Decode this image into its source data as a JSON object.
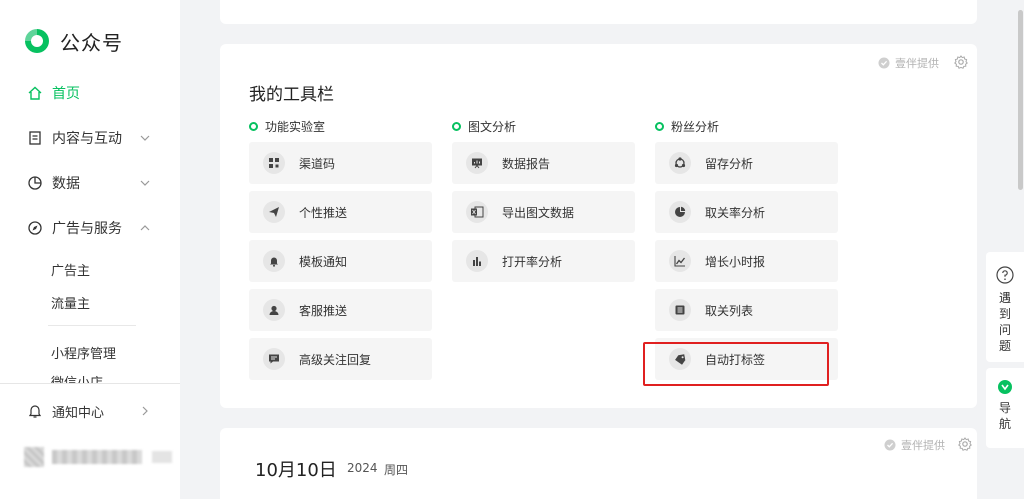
{
  "app": {
    "logo_text": "公众号",
    "brand_color": "#07c160"
  },
  "sidebar": {
    "items": [
      {
        "label": "首页",
        "icon": "home-icon",
        "active": true
      },
      {
        "label": "内容与互动",
        "icon": "document-icon",
        "chevron": "down"
      },
      {
        "label": "数据",
        "icon": "pie-chart-icon",
        "chevron": "down"
      },
      {
        "label": "广告与服务",
        "icon": "compass-icon",
        "chevron": "up"
      }
    ],
    "sub_items": [
      "广告主",
      "流量主",
      "小程序管理",
      "微信小店"
    ],
    "notification": {
      "label": "通知中心",
      "icon": "bell-icon"
    }
  },
  "tools_card": {
    "title": "我的工具栏",
    "sponsor_label": "壹伴提供",
    "columns": [
      {
        "heading": "功能实验室",
        "tools": [
          {
            "label": "渠道码",
            "icon": "qrcode-icon"
          },
          {
            "label": "个性推送",
            "icon": "send-icon"
          },
          {
            "label": "模板通知",
            "icon": "bell-icon"
          },
          {
            "label": "客服推送",
            "icon": "customer-service-icon"
          },
          {
            "label": "高级关注回复",
            "icon": "message-icon"
          }
        ]
      },
      {
        "heading": "图文分析",
        "tools": [
          {
            "label": "数据报告",
            "icon": "presentation-icon"
          },
          {
            "label": "导出图文数据",
            "icon": "excel-icon"
          },
          {
            "label": "打开率分析",
            "icon": "bar-chart-icon"
          }
        ]
      },
      {
        "heading": "粉丝分析",
        "tools": [
          {
            "label": "留存分析",
            "icon": "retention-icon"
          },
          {
            "label": "取关率分析",
            "icon": "pie-chart-icon"
          },
          {
            "label": "增长小时报",
            "icon": "line-chart-icon"
          },
          {
            "label": "取关列表",
            "icon": "list-icon"
          },
          {
            "label": "自动打标签",
            "icon": "tag-icon"
          }
        ]
      }
    ]
  },
  "date_card": {
    "sponsor_label": "壹伴提供",
    "date": "10月10日",
    "year": "2024",
    "weekday": "周四"
  },
  "float": {
    "help_label": "遇到问题",
    "nav_label": "导航"
  }
}
